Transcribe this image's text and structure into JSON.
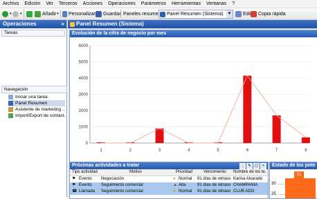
{
  "menu": [
    "Archivo",
    "Edición",
    "Ver",
    "Terceros",
    "Acciones",
    "Operaciones",
    "Parámetros",
    "Herramientas",
    "Ventanas",
    "?"
  ],
  "toolbar": {
    "add_label": "Añadir",
    "customize_label": "Personalizar",
    "save_label": "Guardar",
    "panels_label": "Paneles resumen",
    "panel_select": "Panel Resumen (Sistema)",
    "edit_label": "Editar",
    "quick_copy_label": "Copia rápida"
  },
  "left": {
    "title": "Operaciones",
    "tasks_label": "Tareas",
    "nav_label": "Navegación",
    "nav_items": [
      "Iniciar una tarea",
      "Panel Resumen",
      "Asistente de marketing ...",
      "Import/Export de contact..."
    ]
  },
  "main": {
    "title": "Panel Resumen (Sistema)"
  },
  "chart_data": {
    "type": "bar",
    "title": "Evolución de la cifra de negocio por mes",
    "categories": [
      "1",
      "2",
      "3",
      "4",
      "5",
      "6",
      "7",
      "8"
    ],
    "values": [
      0,
      0,
      900,
      0,
      0,
      4150,
      1700,
      350
    ],
    "ylim": [
      0,
      6000
    ],
    "yticks": [
      "0",
      "1000",
      "2000",
      "3000",
      "4000",
      "5000",
      "6000"
    ],
    "overlay_line": true,
    "colors": {
      "bar": "#e01010",
      "line": "#f0a8a0"
    }
  },
  "activities": {
    "title": "Próximas actividades a tratar",
    "columns": [
      "Tipo actividad",
      "Motivo",
      "Prioridad",
      "Vencimiento",
      "Nombre de los te..."
    ],
    "rows": [
      {
        "type": "Evento",
        "reason": "Negociación",
        "priority": "Normal",
        "due": "91 días de retraso",
        "name": "Karina Alvarado"
      },
      {
        "type": "Evento",
        "reason": "Seguimiento comercial",
        "priority": "Alta",
        "due": "91 días de retraso",
        "name": "CHAMPANIA"
      },
      {
        "type": "Llamada",
        "reason": "Seguimiento comercial",
        "priority": "Normal",
        "due": "91 días de retraso",
        "name": "CLUB ADO"
      }
    ]
  },
  "estado": {
    "title": "Estado de los pote",
    "axis_30": "30",
    "axis_25": "25",
    "badge": "31"
  }
}
